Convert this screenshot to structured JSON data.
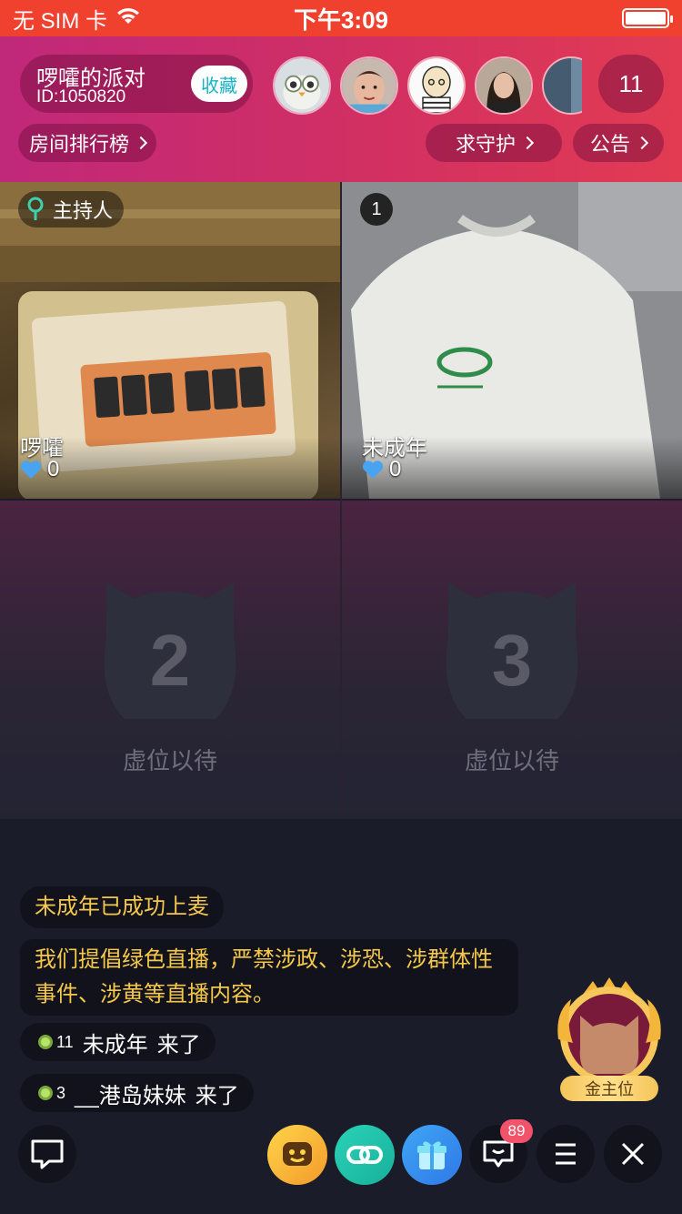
{
  "status_bar": {
    "carrier": "无 SIM 卡",
    "time": "下午3:09"
  },
  "room": {
    "name": "啰嚯的派对",
    "id_text": "ID:1050820",
    "favorite_label": "收藏",
    "audience_count": "11",
    "ranking_label": "房间排行榜",
    "guard_label": "求守护",
    "notice_label": "公告"
  },
  "seats": {
    "host": {
      "badge": "主持人",
      "name": "啰嚯",
      "likes": "0"
    },
    "seat1": {
      "number": "1",
      "name": "未成年",
      "likes": "0"
    },
    "seat2": {
      "number": "2",
      "label": "虚位以待"
    },
    "seat3": {
      "number": "3",
      "label": "虚位以待"
    }
  },
  "chat": {
    "messages": [
      {
        "text": "未成年已成功上麦"
      },
      {
        "text": "我们提倡绿色直播，严禁涉政、涉恐、涉群体性事件、涉黄等直播内容。"
      },
      {
        "level": "11",
        "user": "未成年",
        "action": "来了"
      },
      {
        "level": "3",
        "user": "__港岛妹妹",
        "action": "来了"
      }
    ]
  },
  "gold_seat": {
    "label": "金主位"
  },
  "bottom_bar": {
    "message_badge": "89"
  },
  "colors": {
    "status_bar": "#f0402e",
    "header_start": "#c0287a",
    "header_end": "#e23b52",
    "chat_yellow": "#f5c84c",
    "favorite_text": "#16b4c8",
    "badge_red": "#f2536a"
  },
  "icons": {
    "wifi": "wifi-icon",
    "battery": "battery-icon",
    "host": "host-mic-icon",
    "like": "heart-icon",
    "comment": "comment-icon",
    "emoji": "emoji-icon",
    "link": "link-mic-icon",
    "gift": "gift-icon",
    "message": "message-icon",
    "menu": "menu-icon",
    "close": "close-icon"
  }
}
